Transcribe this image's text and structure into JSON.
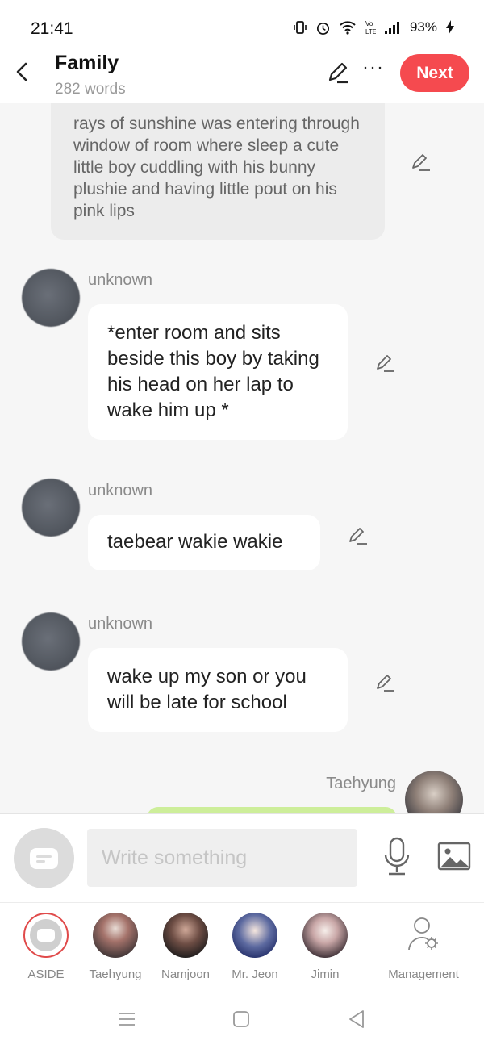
{
  "status_bar": {
    "time": "21:41",
    "battery": "93%"
  },
  "header": {
    "back_icon": "back-arrow-icon",
    "title": "Family",
    "subtitle": "282 words",
    "next_label": "Next"
  },
  "colors": {
    "accent": "#f54a4f",
    "bubble": "#ffffff",
    "narration_bg": "#ececec",
    "self_bubble": "#cdee9a"
  },
  "messages": {
    "narration": {
      "text": "rays of sunshine was entering through window of room where sleep a cute little boy cuddling with his bunny plushie and having little pout on his pink lips"
    },
    "m1": {
      "sender": "unknown",
      "text": "*enter room and sits beside this boy by taking his head on her lap to wake him up *"
    },
    "m2": {
      "sender": "unknown",
      "text": "taebear wakie wakie"
    },
    "m3": {
      "sender": "unknown",
      "text": "wake up my son or you will be late for school"
    },
    "m4": {
      "sender": "Taehyung"
    }
  },
  "input": {
    "placeholder": "Write something"
  },
  "tabs": [
    {
      "label": "ASIDE"
    },
    {
      "label": "Taehyung"
    },
    {
      "label": "Namjoon"
    },
    {
      "label": "Mr. Jeon"
    },
    {
      "label": "Jimin"
    },
    {
      "label": "Management"
    }
  ]
}
